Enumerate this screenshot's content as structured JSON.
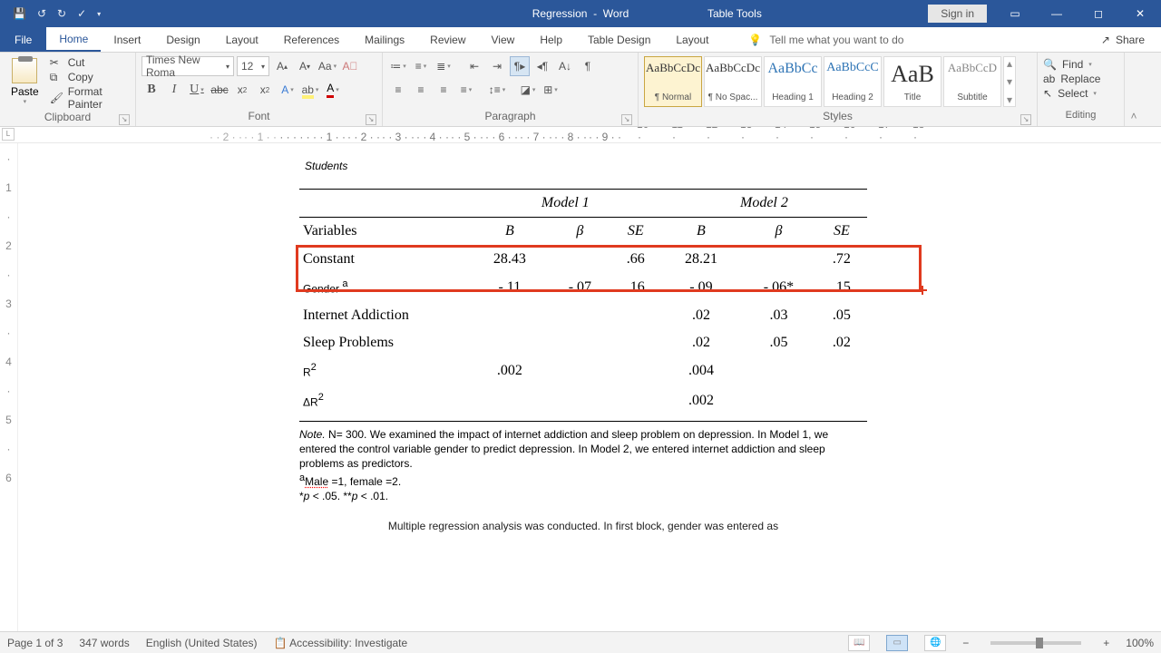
{
  "title": {
    "doc": "Regression",
    "app": "Word",
    "context": "Table Tools"
  },
  "titlebar": {
    "signin": "Sign in"
  },
  "menu": {
    "file": "File",
    "tabs": [
      "Home",
      "Insert",
      "Design",
      "Layout",
      "References",
      "Mailings",
      "Review",
      "View",
      "Help",
      "Table Design",
      "Layout"
    ],
    "active": "Home",
    "tellme": "Tell me what you want to do",
    "share": "Share"
  },
  "ribbon": {
    "clipboard": {
      "label": "Clipboard",
      "paste": "Paste",
      "cut": "Cut",
      "copy": "Copy",
      "fmtpainter": "Format Painter"
    },
    "font": {
      "label": "Font",
      "name": "Times New Roma",
      "size": "12"
    },
    "paragraph": {
      "label": "Paragraph"
    },
    "styles": {
      "label": "Styles",
      "items": [
        {
          "aa": "AaBbCcDc",
          "nm": "¶ Normal"
        },
        {
          "aa": "AaBbCcDc",
          "nm": "¶ No Spac..."
        },
        {
          "aa": "AaBbCc",
          "nm": "Heading 1"
        },
        {
          "aa": "AaBbCcC",
          "nm": "Heading 2"
        },
        {
          "aa": "AaB",
          "nm": "Title"
        },
        {
          "aa": "AaBbCcD",
          "nm": "Subtitle"
        }
      ]
    },
    "editing": {
      "label": "Editing",
      "find": "Find",
      "replace": "Replace",
      "select": "Select"
    }
  },
  "ruler": {
    "corner": "L"
  },
  "document": {
    "heading": "Students",
    "model1": "Model 1",
    "model2": "Model 2",
    "cols": {
      "vars": "Variables",
      "B": "B",
      "beta": "β",
      "SE": "SE"
    },
    "rows": {
      "constant": {
        "label": "Constant",
        "m1B": "28.43",
        "m1b": "",
        "m1SE": ".66",
        "m2B": "28.21",
        "m2b": "",
        "m2SE": ".72"
      },
      "gender": {
        "label": "Gender ",
        "labelSup": "a",
        "m1B": "-.11",
        "m1b": "-.07",
        "m1SE": ".16",
        "m2B": "-.09",
        "m2b": "-.06*",
        "m2SE": ".15"
      },
      "internet": {
        "label": "Internet Addiction",
        "m1B": "",
        "m1b": "",
        "m1SE": "",
        "m2B": ".02",
        "m2b": ".03",
        "m2SE": ".05"
      },
      "sleep": {
        "label": "Sleep Problems",
        "m1B": "",
        "m1b": "",
        "m1SE": "",
        "m2B": ".02",
        "m2b": ".05",
        "m2SE": ".02"
      },
      "r2": {
        "label": "R",
        "sup": "2",
        "m1B": ".002",
        "m2B": ".004"
      },
      "dr2": {
        "label": "ΔR",
        "sup": "2",
        "m2B": ".002"
      }
    },
    "note": {
      "lead": "Note.",
      "body": " N= 300. We examined the impact of internet addiction and sleep problem on depression. In Model 1, we entered the control variable gender to predict depression. In Model 2, we entered internet addiction and sleep problems as predictors.",
      "amale_sup": "a",
      "amale": "Male",
      " amale_tail": " =1, female =2.",
      "p1": "*",
      "pitalic": "p",
      "p2": " < .05. **",
      "p3": " < .01."
    },
    "cutoff": "Multiple regression analysis was conducted. In first block, gender was entered as"
  },
  "status": {
    "page": "Page 1 of 3",
    "words": "347 words",
    "lang": "English (United States)",
    "acc": "Accessibility: Investigate",
    "zoom": "100%"
  }
}
